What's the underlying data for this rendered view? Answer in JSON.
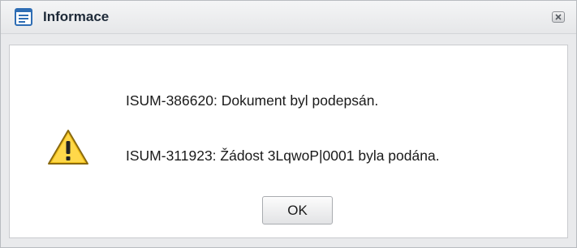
{
  "dialog": {
    "title": "Informace",
    "title_icon": "form-document-icon",
    "close_icon": "close-icon"
  },
  "body": {
    "status_icon": "warning-triangle-icon",
    "messages": [
      "ISUM-386620: Dokument byl podepsán.",
      "ISUM-311923: Žádost 3LqwoP|0001 byla podána."
    ],
    "ok_label": "OK"
  },
  "colors": {
    "warning_yellow": "#f3c21a",
    "title_icon_blue": "#2e6db4"
  }
}
